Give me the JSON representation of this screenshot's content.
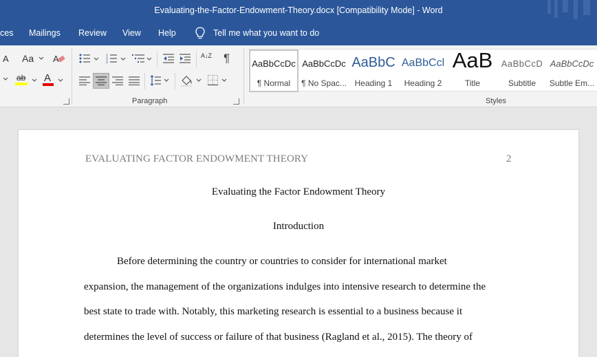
{
  "window": {
    "title": "Evaluating-the-Factor-Endowment-Theory.docx [Compatibility Mode]  -  Word"
  },
  "menu": {
    "tabs": [
      "ces",
      "Mailings",
      "Review",
      "View",
      "Help"
    ],
    "tell_me": "Tell me what you want to do"
  },
  "ribbon": {
    "font_size_glyph": "A",
    "change_case_glyph": "Aa",
    "highlight_glyph": "ab",
    "font_color_glyph": "A",
    "highlight_color": "#ffff00",
    "font_color": "#e00000",
    "paragraph_mark_glyph": "¶",
    "sort_glyph": "A↓Z",
    "paragraph_label": "Paragraph",
    "styles_label": "Styles",
    "styles": [
      {
        "sample": "AaBbCcDc",
        "name": "¶ Normal"
      },
      {
        "sample": "AaBbCcDc",
        "name": "¶ No Spac..."
      },
      {
        "sample": "AaBbC",
        "name": "Heading 1"
      },
      {
        "sample": "AaBbCcl",
        "name": "Heading 2"
      },
      {
        "sample": "AaB",
        "name": "Title"
      },
      {
        "sample": "AaBbCcD",
        "name": "Subtitle"
      },
      {
        "sample": "AaBbCcDc",
        "name": "Subtle Em..."
      }
    ]
  },
  "document": {
    "running_head": "EVALUATING FACTOR ENDOWMENT THEORY",
    "page_number": "2",
    "title": "Evaluating the Factor Endowment Theory",
    "heading": "Introduction",
    "lines": [
      "Before determining the country or countries to consider for international market",
      "expansion, the management of the organizations indulges into intensive research to determine the",
      "best state to trade with. Notably, this marketing research is essential to a business because it",
      "determines the level of success or failure of that business (Ragland et al., 2015). The theory of"
    ]
  },
  "colors": {
    "brand": "#2b579a",
    "ribbon": "#f3f3f3",
    "canvas": "#e6e6e6"
  }
}
